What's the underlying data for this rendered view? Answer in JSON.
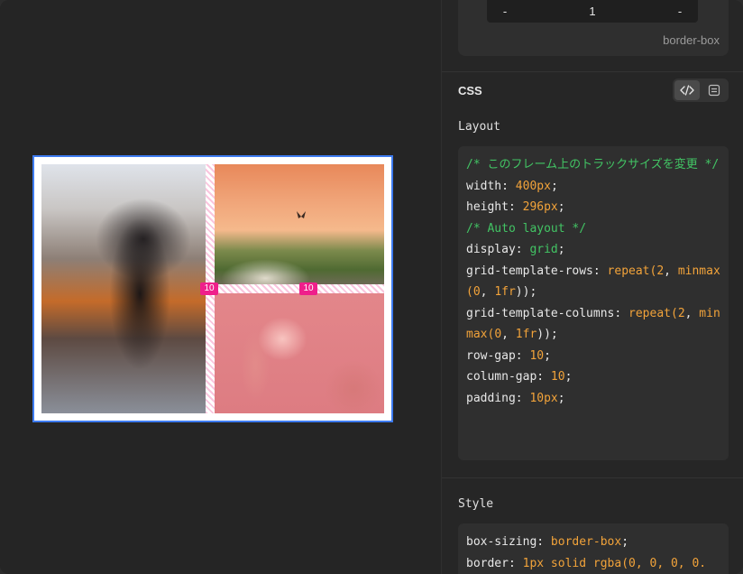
{
  "canvas": {
    "gap_badges": [
      "10",
      "10"
    ]
  },
  "panel": {
    "box_sizing": {
      "left_value": "-",
      "center_value": "1",
      "right_value": "-",
      "label": "border-box"
    },
    "css_section": {
      "title": "CSS",
      "toggle_options": [
        "code-icon",
        "list-icon"
      ]
    },
    "layout_section": {
      "title": "Layout",
      "code_lines": [
        [
          {
            "t": "/* このフレーム上のトラックサイズを変更 */",
            "c": "comment"
          }
        ],
        [
          {
            "t": "width: ",
            "c": "prop"
          },
          {
            "t": "400px",
            "c": "val"
          },
          {
            "t": ";",
            "c": "prop"
          }
        ],
        [
          {
            "t": "height: ",
            "c": "prop"
          },
          {
            "t": "296px",
            "c": "val"
          },
          {
            "t": ";",
            "c": "prop"
          }
        ],
        [
          {
            "t": "/* Auto layout */",
            "c": "comment"
          }
        ],
        [
          {
            "t": "display: ",
            "c": "prop"
          },
          {
            "t": "grid",
            "c": "green"
          },
          {
            "t": ";",
            "c": "prop"
          }
        ],
        [
          {
            "t": "grid-template-rows: ",
            "c": "prop"
          },
          {
            "t": "repeat(",
            "c": "val"
          },
          {
            "t": "2",
            "c": "val"
          },
          {
            "t": ", ",
            "c": "prop"
          },
          {
            "t": "minmax(",
            "c": "val"
          },
          {
            "t": "0",
            "c": "val"
          },
          {
            "t": ", ",
            "c": "prop"
          },
          {
            "t": "1fr",
            "c": "val"
          },
          {
            "t": "));",
            "c": "prop"
          }
        ],
        [
          {
            "t": "grid-template-columns: ",
            "c": "prop"
          },
          {
            "t": "repeat(",
            "c": "val"
          },
          {
            "t": "2",
            "c": "val"
          },
          {
            "t": ", ",
            "c": "prop"
          },
          {
            "t": "minmax(",
            "c": "val"
          },
          {
            "t": "0",
            "c": "val"
          },
          {
            "t": ", ",
            "c": "prop"
          },
          {
            "t": "1fr",
            "c": "val"
          },
          {
            "t": "));",
            "c": "prop"
          }
        ],
        [
          {
            "t": "row-gap: ",
            "c": "prop"
          },
          {
            "t": "10",
            "c": "val"
          },
          {
            "t": ";",
            "c": "prop"
          }
        ],
        [
          {
            "t": "column-gap: ",
            "c": "prop"
          },
          {
            "t": "10",
            "c": "val"
          },
          {
            "t": ";",
            "c": "prop"
          }
        ],
        [
          {
            "t": "padding: ",
            "c": "prop"
          },
          {
            "t": "10px",
            "c": "val"
          },
          {
            "t": ";",
            "c": "prop"
          }
        ]
      ]
    },
    "style_section": {
      "title": "Style",
      "code_lines": [
        [
          {
            "t": "box-sizing: ",
            "c": "prop"
          },
          {
            "t": "border-box",
            "c": "val"
          },
          {
            "t": ";",
            "c": "prop"
          }
        ],
        [
          {
            "t": "border: ",
            "c": "prop"
          },
          {
            "t": "1px solid rgba(0, 0, 0, 0.",
            "c": "val"
          }
        ]
      ]
    }
  },
  "colors": {
    "selection": "#3d7bf0",
    "gap_badge": "#ef1f8b",
    "code_comment": "#42c464",
    "code_value": "#f2a33a"
  }
}
